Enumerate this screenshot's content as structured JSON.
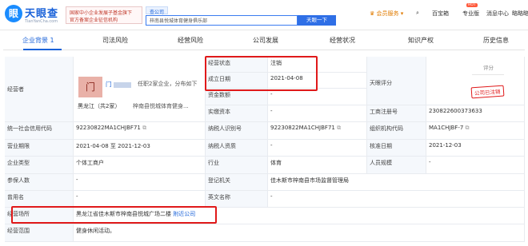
{
  "brand": {
    "name": "天眼查",
    "domain": "TianYanCha.com"
  },
  "banner": {
    "line1": "国家中小企业发展子基金旗下",
    "line2": "官方备案企业征信机构"
  },
  "search": {
    "tab": "查公司",
    "value": "梓南县悦城体育健身俱乐部",
    "button": "天眼一下"
  },
  "header": {
    "vip": "会员服务",
    "app": "百宝箱",
    "pro": "专业版",
    "msg": "消息中心",
    "user": "略略略略",
    "hot": "HOT"
  },
  "tabs": [
    {
      "label": "企业背景",
      "count": "1"
    },
    {
      "label": "司法风险"
    },
    {
      "label": "经营风险"
    },
    {
      "label": "公司发展"
    },
    {
      "label": "经营状况"
    },
    {
      "label": "知识产权"
    },
    {
      "label": "历史信息"
    }
  ],
  "table": {
    "operator_label": "经营者",
    "operator_name": "门",
    "operator_suffix": "任职2家企业，分布如下",
    "operator_region": "黑龙江（共2家）",
    "operator_company": "梓南县悦城体育健身...",
    "status_label": "经营状态",
    "status_value": "注销",
    "date_label": "成立日期",
    "date_value": "2021-04-08",
    "capital_label": "资金数额",
    "capital_value": "-",
    "paid_label": "实缴资本",
    "paid_value": "-",
    "sky_label": "天眼评分",
    "score": "评分",
    "status_tag": "公司已注销",
    "reg_no_label": "工商注册号",
    "reg_no_value": "230822600373633",
    "credit_label": "统一社会信用代码",
    "credit_value": "92230822MA1CHJBF71",
    "tax_label": "纳税人识别号",
    "tax_value": "92230822MA1CHJBF71",
    "org_label": "组织机构代码",
    "org_value": "MA1CHJBF-7",
    "term_label": "营业期限",
    "term_value": "2021-04-08 至 2021-12-03",
    "taxq_label": "纳税人资质",
    "taxq_value": "-",
    "approve_label": "核准日期",
    "approve_value": "2021-12-03",
    "type_label": "企业类型",
    "type_value": "个体工商户",
    "industry_label": "行业",
    "industry_value": "体育",
    "staff_label": "人员规模",
    "staff_value": "-",
    "insured_label": "参保人数",
    "insured_value": "-",
    "authority_label": "登记机关",
    "authority_value": "佳木斯市梓南县市场监督管理局",
    "former_label": "曾用名",
    "former_value": "-",
    "en_label": "英文名称",
    "en_value": "-",
    "address_label": "经营场所",
    "address_value": "黑龙江省佳木斯市梓南县悦城广场二楼",
    "address_link": "附近公司",
    "scope_label": "经营范围",
    "scope_value": "健身休闲活动。"
  }
}
